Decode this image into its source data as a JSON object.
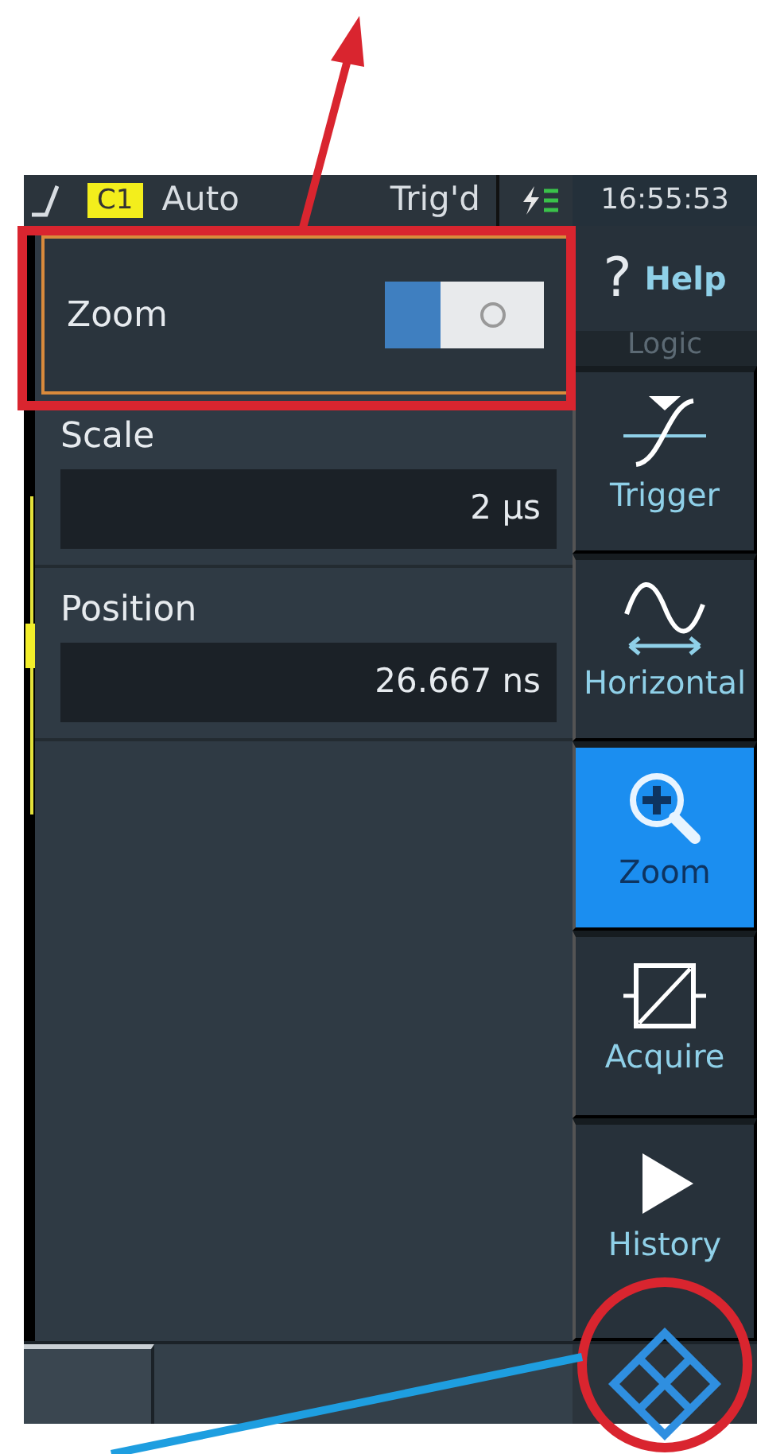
{
  "status_bar": {
    "channel": "C1",
    "mode": "Auto",
    "trigger_state": "Trig'd",
    "time": "16:55:53"
  },
  "panel": {
    "toggle": {
      "label": "Zoom",
      "on": true
    },
    "fields": [
      {
        "label": "Scale",
        "value": "2 µs"
      },
      {
        "label": "Position",
        "value": "26.667 ns"
      }
    ]
  },
  "sidebar": {
    "help": {
      "icon": "?",
      "label": "Help"
    },
    "covered_label": "Logic",
    "items": [
      {
        "kind": "trigger",
        "label": "Trigger",
        "selected": false
      },
      {
        "kind": "horizontal",
        "label": "Horizontal",
        "selected": false
      },
      {
        "kind": "zoom",
        "label": "Zoom",
        "selected": true
      },
      {
        "kind": "acquire",
        "label": "Acquire",
        "selected": false
      },
      {
        "kind": "history",
        "label": "History",
        "selected": false
      }
    ]
  }
}
